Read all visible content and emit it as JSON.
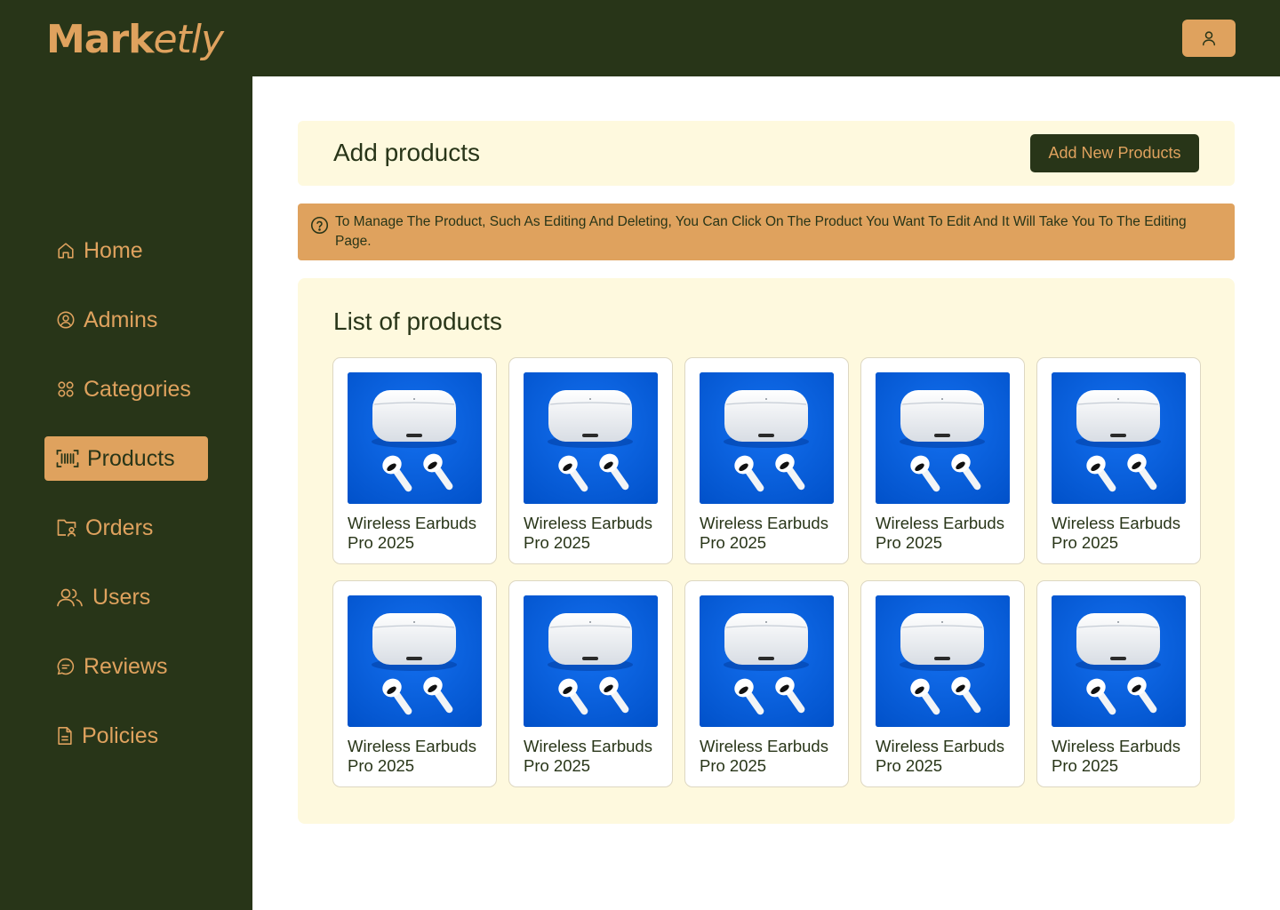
{
  "app": {
    "logo_main": "Mark",
    "logo_italic": "etly"
  },
  "topbar": {
    "user_icon": "user-icon"
  },
  "sidebar": {
    "items": [
      {
        "label": "Home",
        "icon": "home-icon"
      },
      {
        "label": "Admins",
        "icon": "user-circle-icon"
      },
      {
        "label": "Categories",
        "icon": "category-grid-icon"
      },
      {
        "label": "Products",
        "icon": "barcode-icon",
        "active": true
      },
      {
        "label": "Orders",
        "icon": "folder-user-icon"
      },
      {
        "label": "Users",
        "icon": "users-icon"
      },
      {
        "label": "Reviews",
        "icon": "chat-icon"
      },
      {
        "label": "Policies",
        "icon": "document-icon"
      }
    ]
  },
  "header": {
    "title": "Add products",
    "add_button": "Add New Products"
  },
  "notice": {
    "icon": "help-circle-icon",
    "text": "To Manage The Product, Such As Editing And Deleting, You Can Click On The Product You Want To Edit And It Will Take You To The Editing Page."
  },
  "products": {
    "title": "List of products",
    "items": [
      {
        "name": "Wireless Earbuds Pro 2025"
      },
      {
        "name": "Wireless Earbuds Pro 2025"
      },
      {
        "name": "Wireless Earbuds Pro 2025"
      },
      {
        "name": "Wireless Earbuds Pro 2025"
      },
      {
        "name": "Wireless Earbuds Pro 2025"
      },
      {
        "name": "Wireless Earbuds Pro 2025"
      },
      {
        "name": "Wireless Earbuds Pro 2025"
      },
      {
        "name": "Wireless Earbuds Pro 2025"
      },
      {
        "name": "Wireless Earbuds Pro 2025"
      },
      {
        "name": "Wireless Earbuds Pro 2025"
      }
    ]
  },
  "colors": {
    "dark_green": "#283518",
    "accent_orange": "#dfa25e",
    "cream": "#fef9de",
    "product_bg_blue": "#0a5fdc"
  }
}
